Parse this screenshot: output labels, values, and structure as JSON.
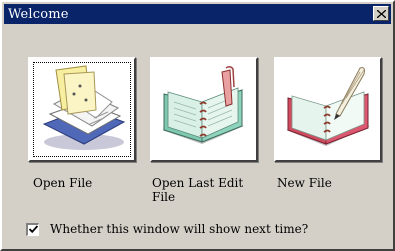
{
  "window": {
    "title": "Welcome",
    "colors": {
      "titlebar": "#0a246a",
      "face": "#d4d0c8"
    }
  },
  "actions": [
    {
      "label": "Open File",
      "icon": "open-file-icon"
    },
    {
      "label": "Open Last Edit File",
      "icon": "open-last-edit-icon"
    },
    {
      "label": "New File",
      "icon": "new-file-icon"
    }
  ],
  "show_next_time": {
    "label": "Whether this window will show next time?",
    "checked": true
  }
}
